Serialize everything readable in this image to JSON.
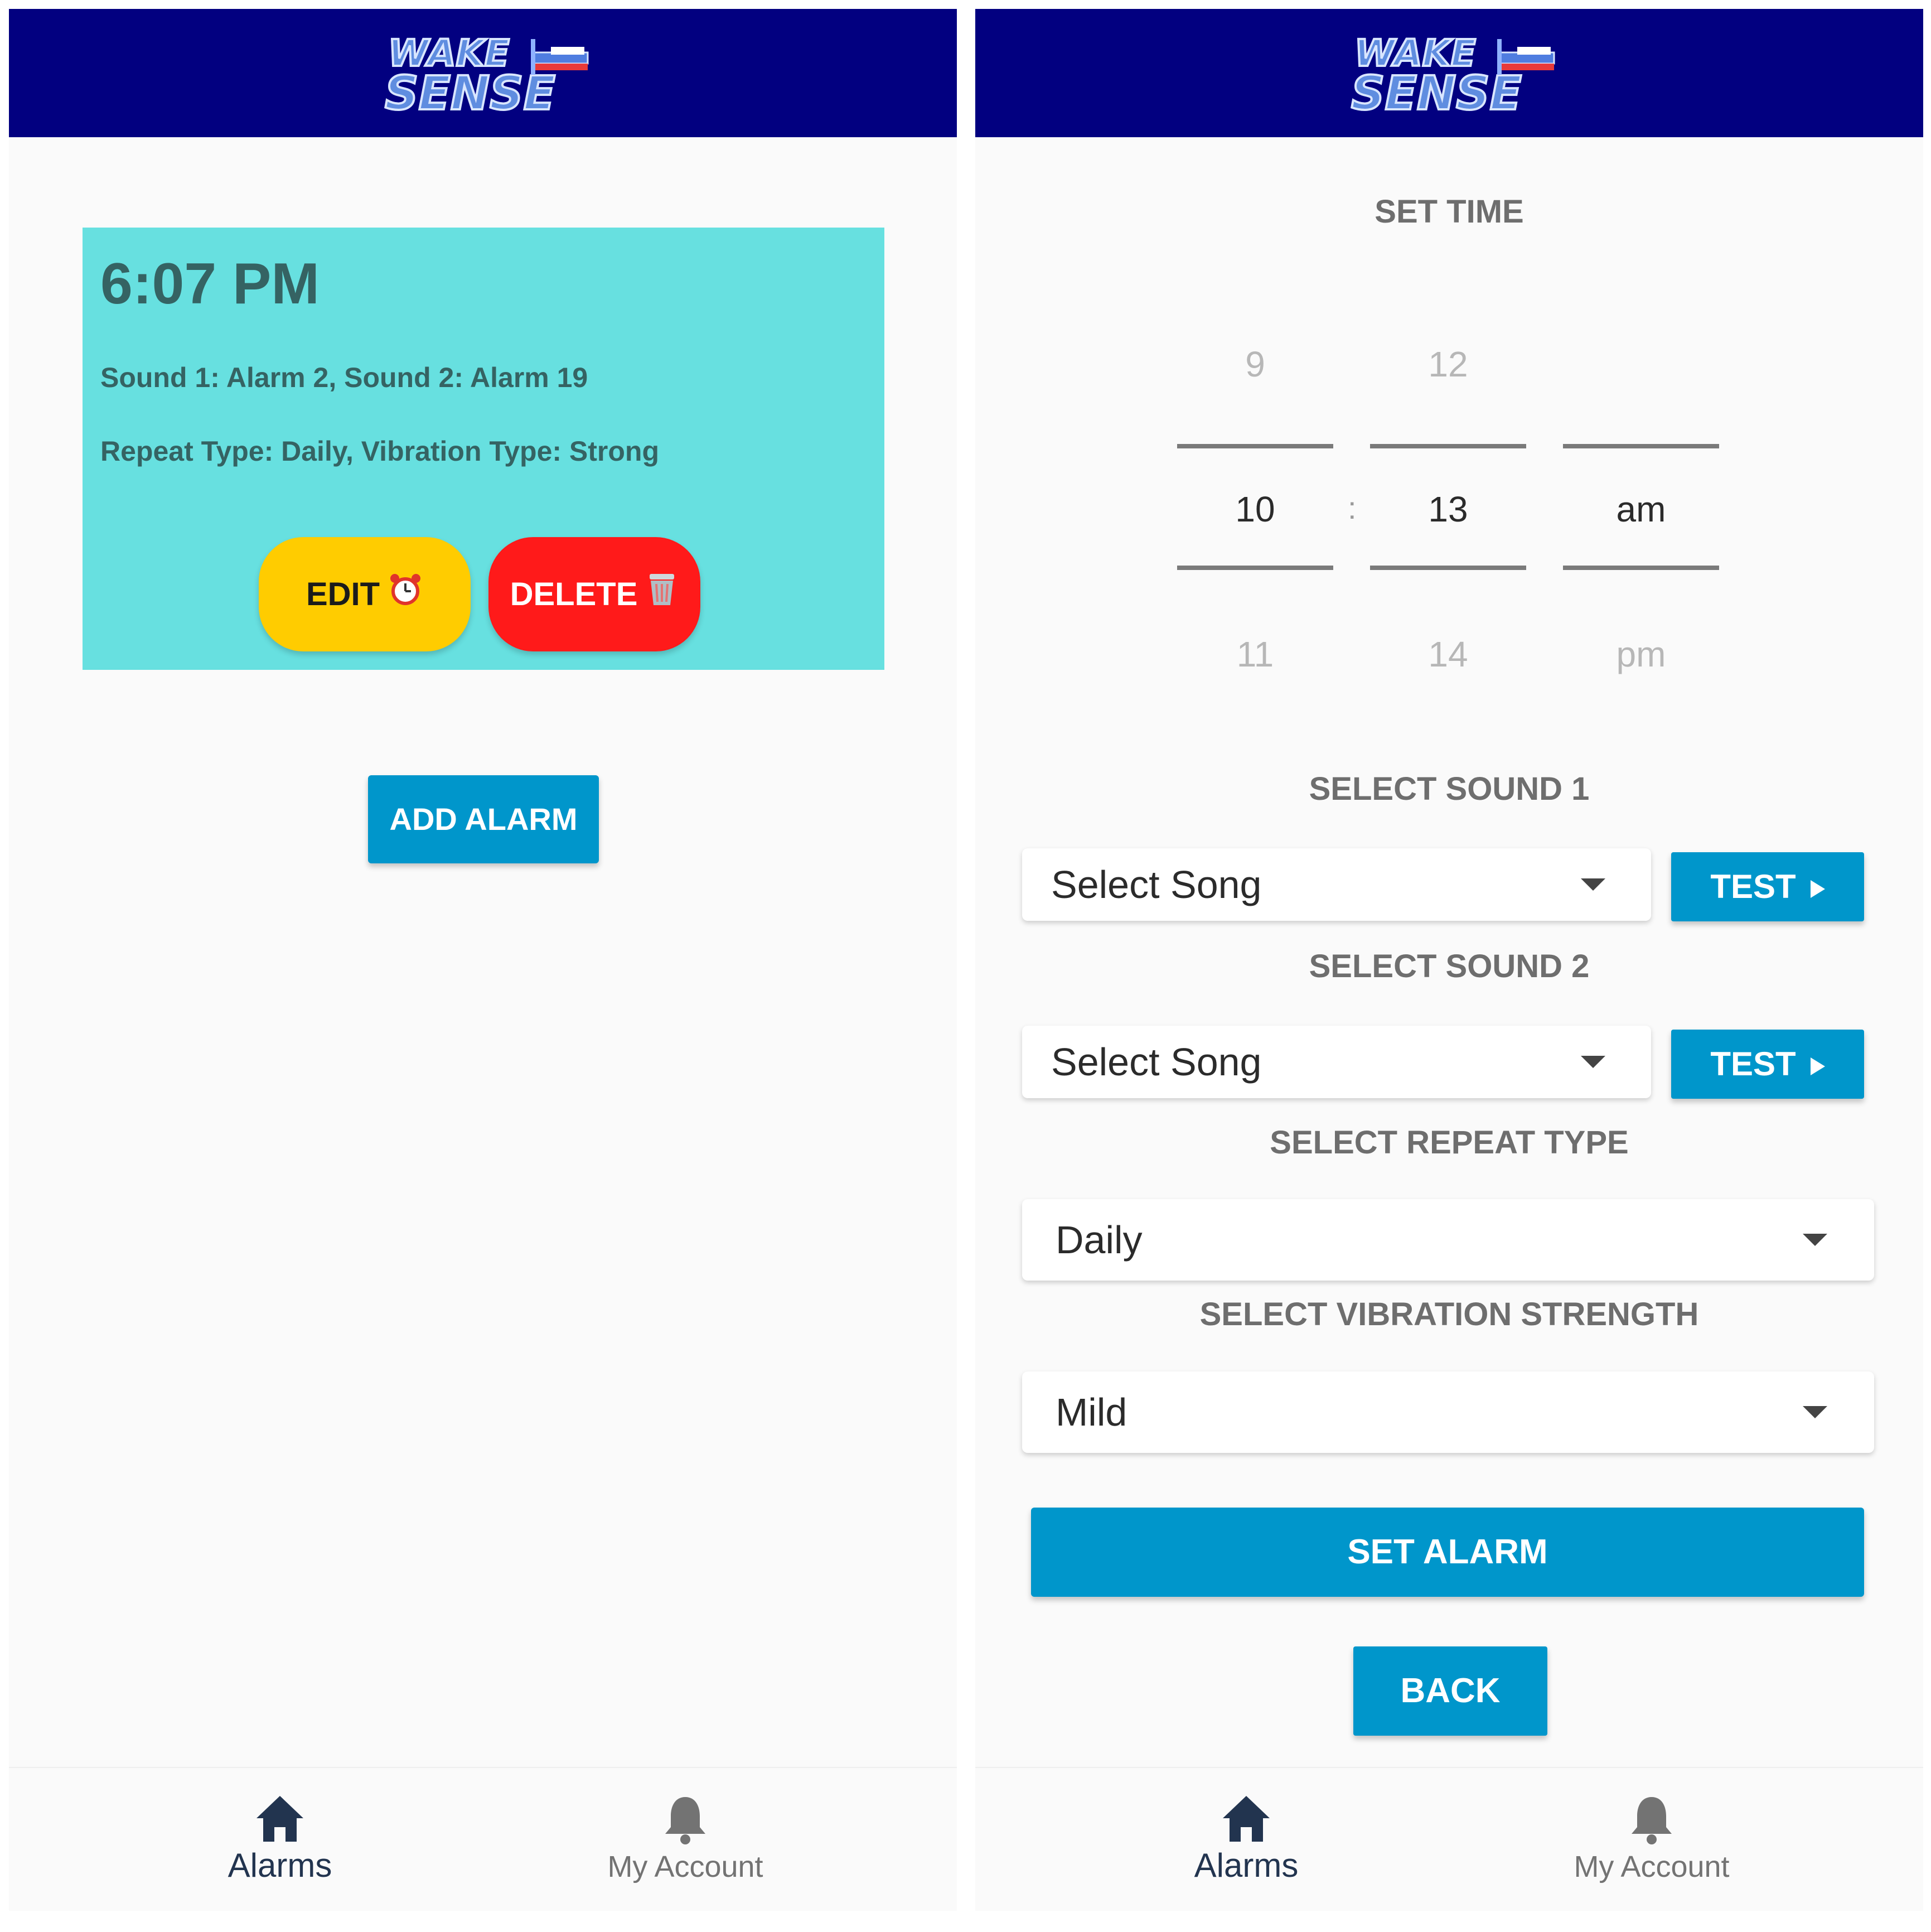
{
  "app": {
    "logo_line1": "WAKE",
    "logo_line2": "SENSE",
    "header_color": "#020080"
  },
  "alarms_screen": {
    "alarm": {
      "time": "6:07 PM",
      "sounds": "Sound 1: Alarm 2, Sound 2: Alarm 19",
      "details": "Repeat Type: Daily, Vibration Type: Strong",
      "card_color": "#67e0e0"
    },
    "edit_label": "EDIT",
    "edit_icon": "alarm-clock-icon",
    "delete_label": "DELETE",
    "delete_icon": "wastebasket-icon",
    "add_alarm_label": "ADD ALARM"
  },
  "edit_screen": {
    "set_time_label": "SET TIME",
    "picker": {
      "hour": {
        "above": "9",
        "selected": "10",
        "below": "11"
      },
      "separator": ":",
      "minute": {
        "above": "12",
        "selected": "13",
        "below": "14"
      },
      "period": {
        "above": "",
        "selected": "am",
        "below": "pm"
      }
    },
    "sound1_label": "SELECT SOUND 1",
    "sound1_value": "Select Song",
    "sound2_label": "SELECT SOUND 2",
    "sound2_value": "Select Song",
    "test_label": "TEST",
    "repeat_label": "SELECT REPEAT TYPE",
    "repeat_value": "Daily",
    "vibration_label": "SELECT VIBRATION STRENGTH",
    "vibration_value": "Mild",
    "set_alarm_label": "SET ALARM",
    "back_label": "BACK",
    "accent_color": "#0096cb"
  },
  "bottom_nav": {
    "items": [
      {
        "label": "Alarms",
        "icon": "home-icon"
      },
      {
        "label": "My Account",
        "icon": "bell-icon"
      }
    ]
  }
}
